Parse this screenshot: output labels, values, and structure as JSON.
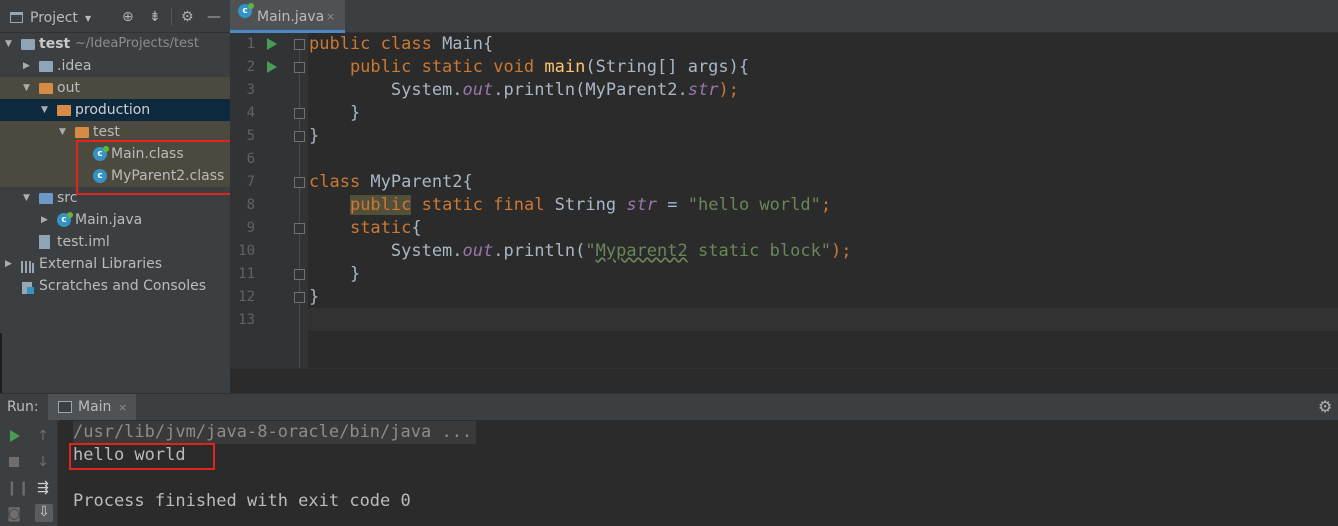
{
  "project": {
    "title": "Project",
    "toolbar_icons": [
      "target-icon",
      "collapse-icon",
      "gear-icon",
      "minimize-icon"
    ],
    "tree": [
      {
        "label": "test",
        "suffix": "~/IdeaProjects/test"
      },
      {
        "label": ".idea"
      },
      {
        "label": "out"
      },
      {
        "label": "production"
      },
      {
        "label": "test"
      },
      {
        "label": "Main.class"
      },
      {
        "label": "MyParent2.class"
      },
      {
        "label": "src"
      },
      {
        "label": "Main.java"
      },
      {
        "label": "test.iml"
      },
      {
        "label": "External Libraries"
      },
      {
        "label": "Scratches and Consoles"
      }
    ]
  },
  "editor": {
    "tab": {
      "label": "Main.java",
      "close": "×"
    },
    "line_numbers": [
      "1",
      "2",
      "3",
      "4",
      "5",
      "6",
      "7",
      "8",
      "9",
      "10",
      "11",
      "12",
      "13"
    ],
    "code": {
      "l1_kw": "public class",
      "l1_rest": " Main{",
      "l2_kw": "    public static void",
      "l2_fn": " main",
      "l2_rest": "(String[] args){",
      "l3_a": "        System.",
      "l3_out": "out",
      "l3_b": ".println(MyParent2.",
      "l3_str": "str",
      "l3_c": ");",
      "l4": "    }",
      "l5": "}",
      "l7_kw": "class",
      "l7_rest": " MyParent2{",
      "l8_indent": "    ",
      "l8_pub": "public",
      "l8_kw": " static final",
      "l8_type": " String ",
      "l8_str": "str",
      "l8_eq": " = ",
      "l8_val": "\"hello world\"",
      "l8_end": ";",
      "l9_indent": "    ",
      "l9_kw": "static",
      "l9_rest": "{",
      "l10_a": "        System.",
      "l10_out": "out",
      "l10_b": ".println(",
      "l10_q1": "\"",
      "l10_word": "Myparent2",
      "l10_q2": " static block\"",
      "l10_c": ");",
      "l11": "    }",
      "l12": "}"
    }
  },
  "run": {
    "label": "Run:",
    "tab_label": "Main",
    "tab_close": "×",
    "console": {
      "command": "/usr/lib/jvm/java-8-oracle/bin/java ...",
      "output": "hello world",
      "exit": "Process finished with exit code 0"
    }
  },
  "colors": {
    "accent_highlight": "#e3241c",
    "keyword": "#cc7832",
    "string": "#6a8759",
    "field": "#9876aa",
    "method": "#ffc66d"
  }
}
